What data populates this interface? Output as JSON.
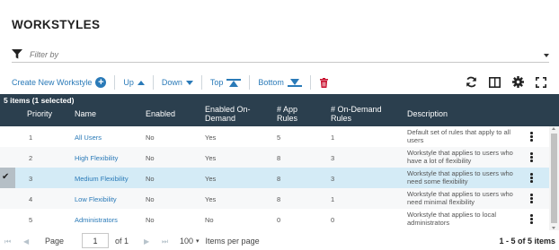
{
  "title": "WORKSTYLES",
  "filter": {
    "placeholder": "Filter by"
  },
  "toolbar": {
    "create_label": "Create New Workstyle",
    "up_label": "Up",
    "down_label": "Down",
    "top_label": "Top",
    "bottom_label": "Bottom"
  },
  "grid": {
    "selection_count": "5 items (1 selected)",
    "columns": {
      "priority": "Priority",
      "name": "Name",
      "enabled": "Enabled",
      "enabled_on_demand": "Enabled On-\nDemand",
      "app_rules": "# App\nRules",
      "on_demand_rules": "# On-Demand\nRules",
      "description": "Description"
    },
    "rows": [
      {
        "priority": "1",
        "name": "All Users",
        "enabled": "No",
        "on_demand": "Yes",
        "app_rules": "5",
        "od_rules": "1",
        "description": "Default set of rules that apply to all users"
      },
      {
        "priority": "2",
        "name": "High Flexibility",
        "enabled": "No",
        "on_demand": "Yes",
        "app_rules": "8",
        "od_rules": "3",
        "description": "Workstyle that applies to users who have a lot of flexibility"
      },
      {
        "priority": "3",
        "name": "Medium Flexibility",
        "enabled": "No",
        "on_demand": "Yes",
        "app_rules": "8",
        "od_rules": "3",
        "description": "Workstyle that applies to users who need some flexibility"
      },
      {
        "priority": "4",
        "name": "Low Flexibility",
        "enabled": "No",
        "on_demand": "Yes",
        "app_rules": "8",
        "od_rules": "1",
        "description": "Workstyle that applies to users who need minimal flexibility"
      },
      {
        "priority": "5",
        "name": "Administrators",
        "enabled": "No",
        "on_demand": "No",
        "app_rules": "0",
        "od_rules": "0",
        "description": "Workstyle that applies to local administrators"
      }
    ],
    "selected_row": 3
  },
  "pager": {
    "page_label": "Page",
    "page_value": "1",
    "of_label": "of 1",
    "page_size": "100",
    "per_page_label": "Items per page",
    "count": "1 - 5 of 5 items"
  },
  "colors": {
    "accent": "#2a7ab8",
    "header_bg": "#2b3f4e",
    "selected_row": "#d4ebf6",
    "delete": "#c8102e"
  }
}
